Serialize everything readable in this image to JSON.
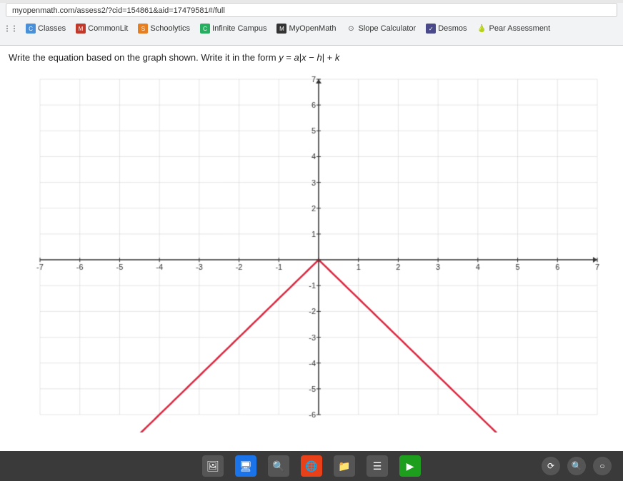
{
  "browser": {
    "address": "myopenmath.com/assess2/?cid=154861&aid=17479581#/full",
    "bookmarks": [
      {
        "label": "Classes",
        "icon": "classes"
      },
      {
        "label": "CommonLit",
        "icon": "commonlit"
      },
      {
        "label": "Schoolytics",
        "icon": "schoolytics"
      },
      {
        "label": "Infinite Campus",
        "icon": "campus"
      },
      {
        "label": "MyOpenMath",
        "icon": "myopenmath"
      },
      {
        "label": "Slope Calculator",
        "icon": "slope"
      },
      {
        "label": "Desmos",
        "icon": "desmos"
      },
      {
        "label": "Pear Assessment",
        "icon": "pear"
      }
    ]
  },
  "question": {
    "text": "Write the equation based on the graph shown. Write it in the form y = a|x − h| + k"
  },
  "graph": {
    "x_min": -7,
    "x_max": 7,
    "y_min": -6,
    "y_max": 7
  },
  "taskbar": {
    "icons": [
      "🖼",
      "🖥",
      "🔍",
      "🌐",
      "📁",
      "☰",
      "▶"
    ]
  }
}
